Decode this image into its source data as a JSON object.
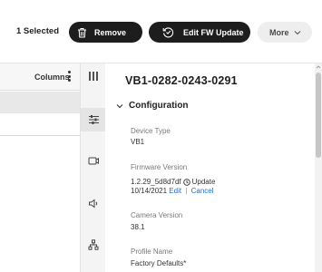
{
  "toolbar": {
    "selected_text": "1 Selected",
    "remove_label": "Remove",
    "edit_fw_label": "Edit FW Update",
    "more_label": "More"
  },
  "table": {
    "columns_label": "Columns"
  },
  "rail": {
    "icons": [
      "columns-icon",
      "sliders-icon",
      "camera-icon",
      "speaker-icon",
      "network-icon"
    ],
    "active_index": 1
  },
  "panel": {
    "device_title": "VB1-0282-0243-0291",
    "section_label": "Configuration",
    "device_type_label": "Device Type",
    "device_type_value": "VB1",
    "firmware_label": "Firmware Version",
    "firmware_value": "1.2.29_5d8d7df",
    "firmware_update_text": "Update",
    "firmware_date": "10/14/2021",
    "edit_link": "Edit",
    "separator": "|",
    "cancel_link": "Cancel",
    "camera_version_label": "Camera Version",
    "camera_version_value": "38.1",
    "profile_label": "Profile Name",
    "profile_value": "Factory Defaults*"
  },
  "colors": {
    "primary_dark": "#1d1d1d",
    "link_blue": "#1f6fcf",
    "rail_active": "#e4e4e4"
  }
}
